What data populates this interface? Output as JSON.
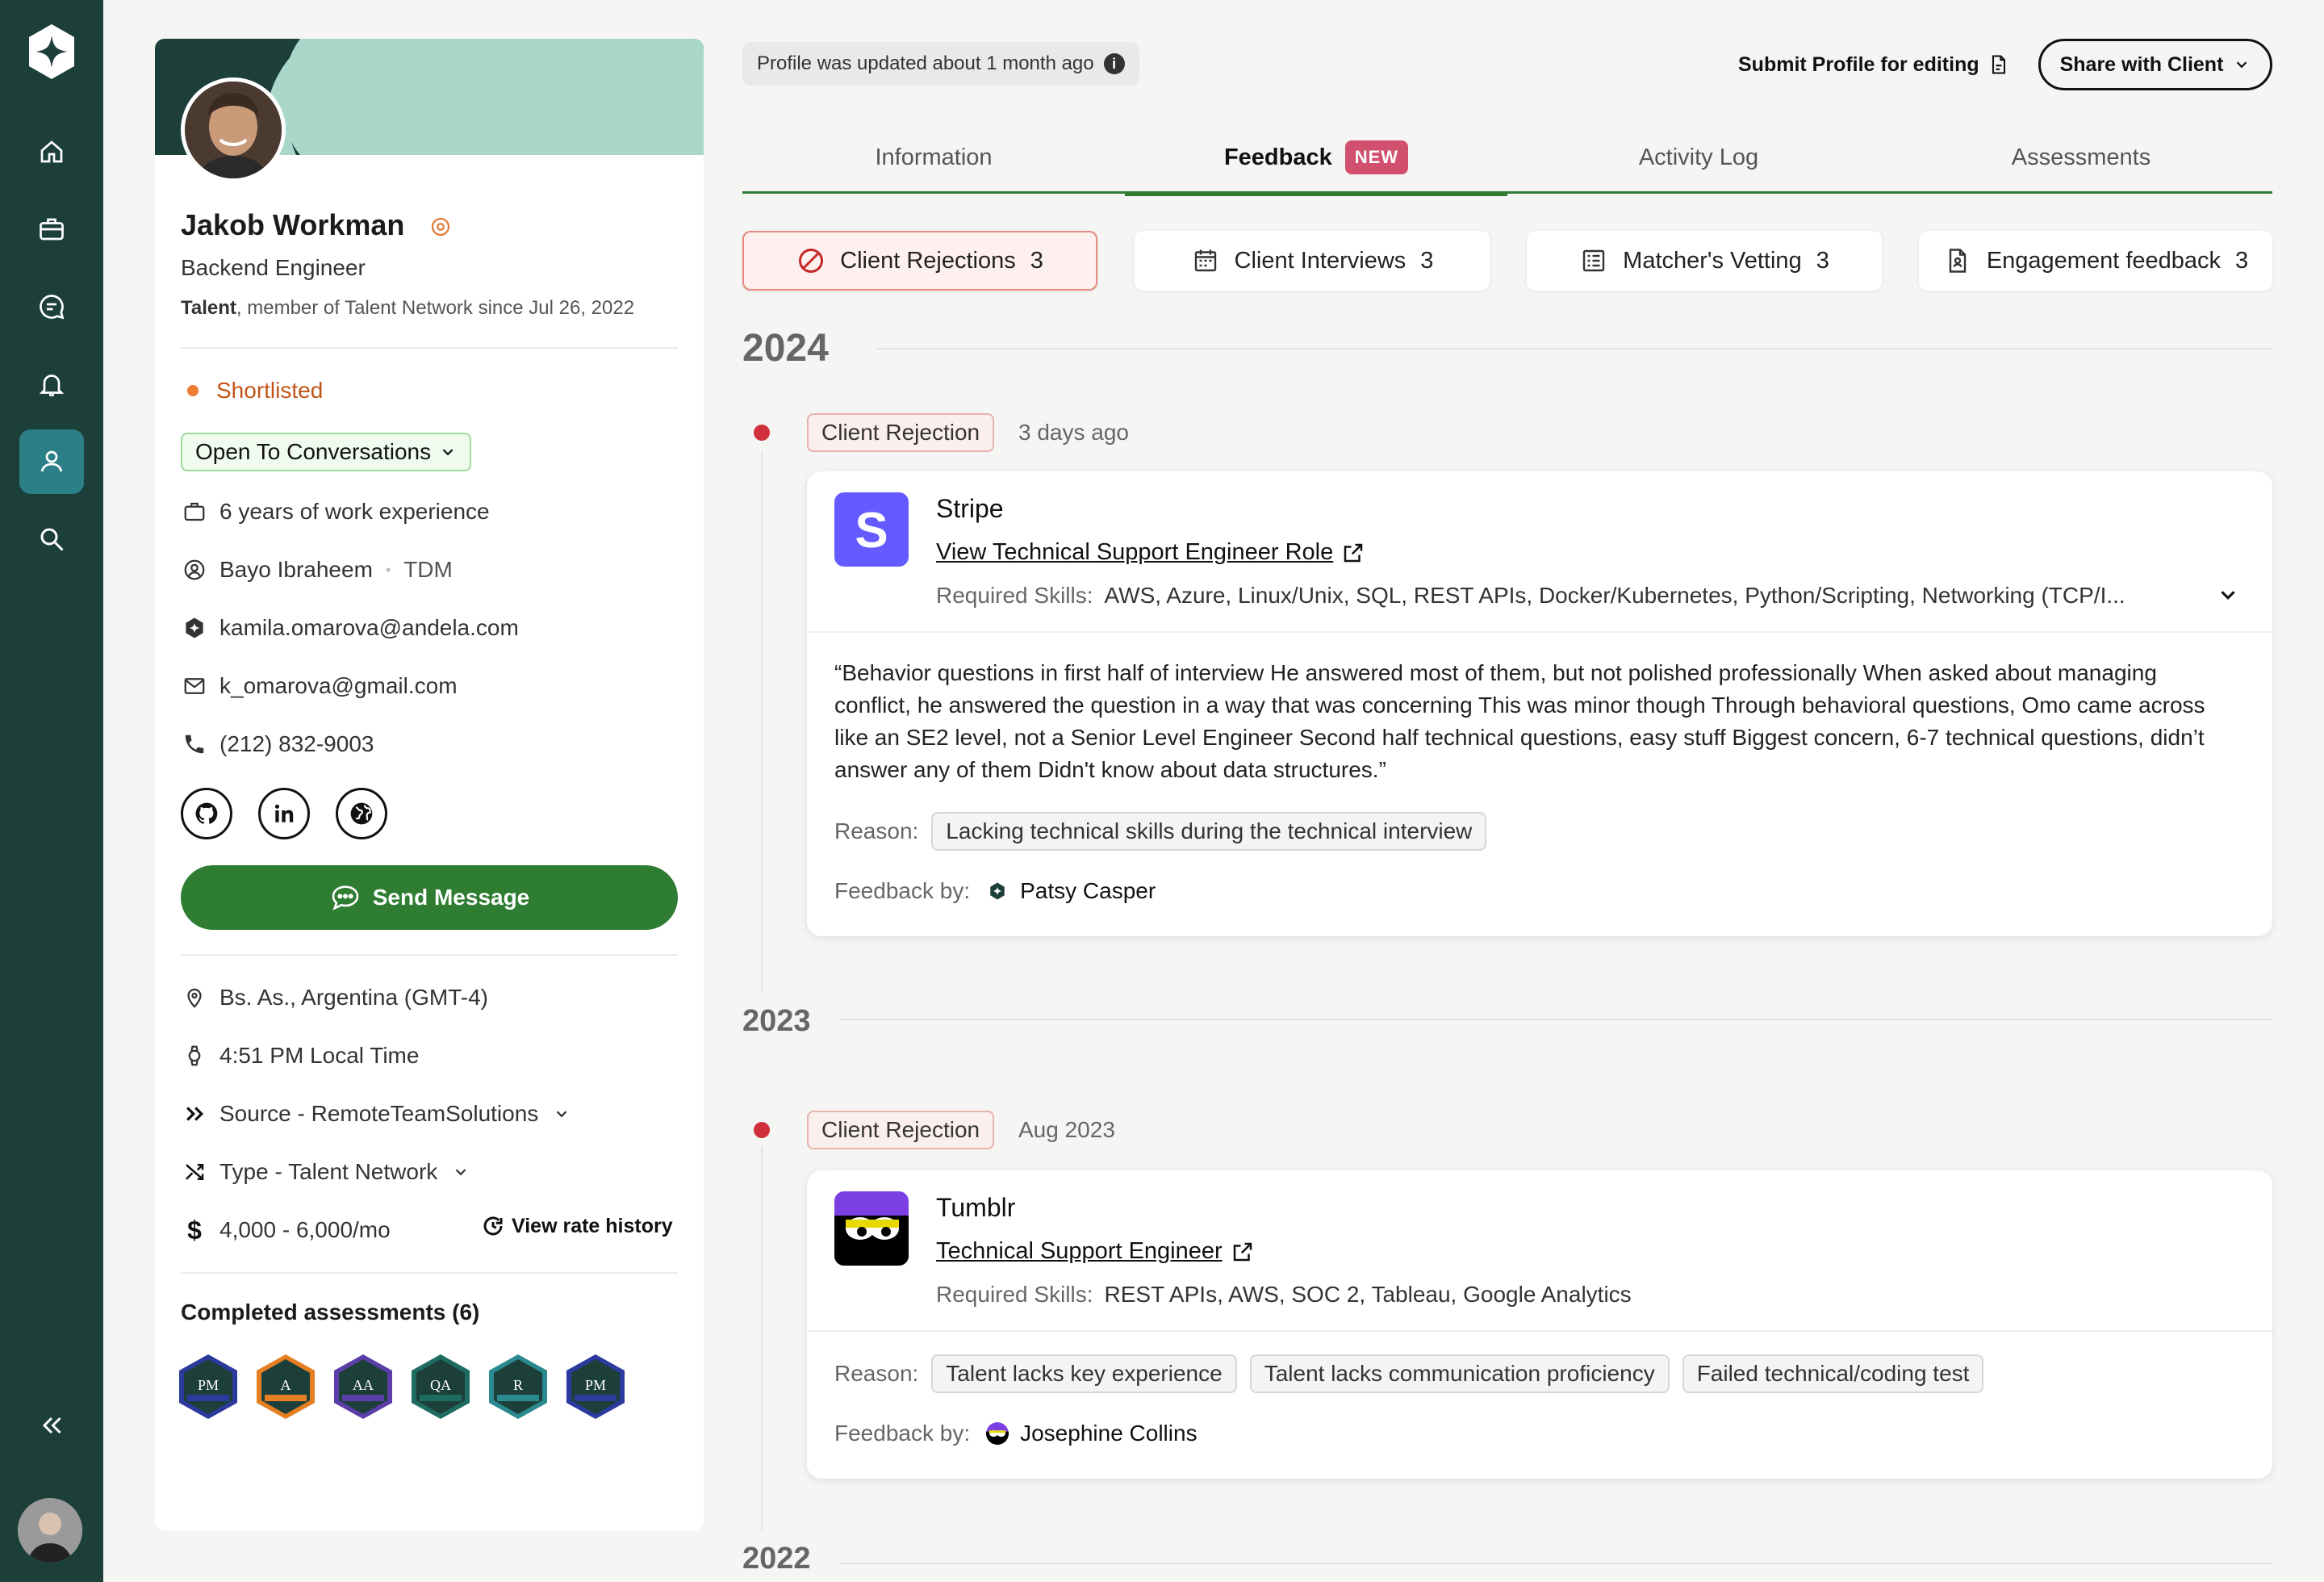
{
  "profile": {
    "name": "Jakob Workman",
    "title": "Backend Engineer",
    "member_role": "Talent",
    "member_since": ", member of Talent Network since Jul 26, 2022",
    "status": "Shortlisted",
    "availability": "Open To Conversations",
    "experience": "6 years of work experience",
    "recruiter": "Bayo Ibraheem",
    "recruiter_role": "TDM",
    "work_email": "kamila.omarova@andela.com",
    "personal_email": "k_omarova@gmail.com",
    "phone": "(212) 832-9003",
    "send_message": "Send Message",
    "location": "Bs. As., Argentina (GMT-4)",
    "local_time": "4:51 PM Local Time",
    "source": "Source - RemoteTeamSolutions",
    "type": "Type - Talent Network",
    "rate": "4,000 - 6,000/mo",
    "rate_history": "View rate history",
    "assessments_title": "Completed assessments (6)",
    "assessments": [
      {
        "abbr": "PM",
        "color": "#2c3a9e"
      },
      {
        "abbr": "A",
        "color": "#e67e22"
      },
      {
        "abbr": "AA",
        "color": "#5b3ea8"
      },
      {
        "abbr": "QA",
        "color": "#1e6b62"
      },
      {
        "abbr": "R",
        "color": "#2a8a8f"
      },
      {
        "abbr": "PM",
        "color": "#2c3a9e"
      }
    ]
  },
  "header": {
    "updated": "Profile was updated about 1 month ago",
    "submit": "Submit Profile for editing",
    "share": "Share with Client"
  },
  "tabs": {
    "information": "Information",
    "feedback": "Feedback",
    "new_badge": "NEW",
    "activity": "Activity Log",
    "assessments": "Assessments"
  },
  "filters": [
    {
      "label": "Client Rejections",
      "count": "3"
    },
    {
      "label": "Client Interviews",
      "count": "3"
    },
    {
      "label": "Matcher's Vetting",
      "count": "3"
    },
    {
      "label": "Engagement feedback",
      "count": "3"
    }
  ],
  "years": [
    "2024",
    "2023",
    "2022"
  ],
  "entries": [
    {
      "tag": "Client Rejection",
      "when": "3 days ago",
      "company": "Stripe",
      "role": "View Technical Support Engineer Role",
      "skills_label": "Required Skills:",
      "skills": "AWS, Azure, Linux/Unix, SQL, REST APIs, Docker/Kubernetes, Python/Scripting, Networking (TCP/I...",
      "quote": "“Behavior questions in first half of interview He answered most of them, but not polished professionally When asked about managing conflict, he answered the question in a way that was concerning This was minor though Through behavioral questions, Omo came across like an SE2 level, not a Senior Level Engineer Second half technical questions, easy stuff Biggest concern, 6-7 technical questions, didn’t answer any of them Didn't know about data structures.”",
      "reason_label": "Reason:",
      "reasons": [
        "Lacking technical skills during the technical interview"
      ],
      "feedback_label": "Feedback by:",
      "feedback_by": "Patsy Casper"
    },
    {
      "tag": "Client Rejection",
      "when": "Aug 2023",
      "company": "Tumblr",
      "role": "Technical Support Engineer",
      "skills_label": "Required Skills:",
      "skills": "REST APIs, AWS, SOC 2, Tableau, Google Analytics",
      "reason_label": "Reason:",
      "reasons": [
        "Talent lacks key experience",
        "Talent lacks communication proficiency",
        "Failed technical/coding test"
      ],
      "feedback_label": "Feedback by:",
      "feedback_by": "Josephine Collins"
    }
  ]
}
